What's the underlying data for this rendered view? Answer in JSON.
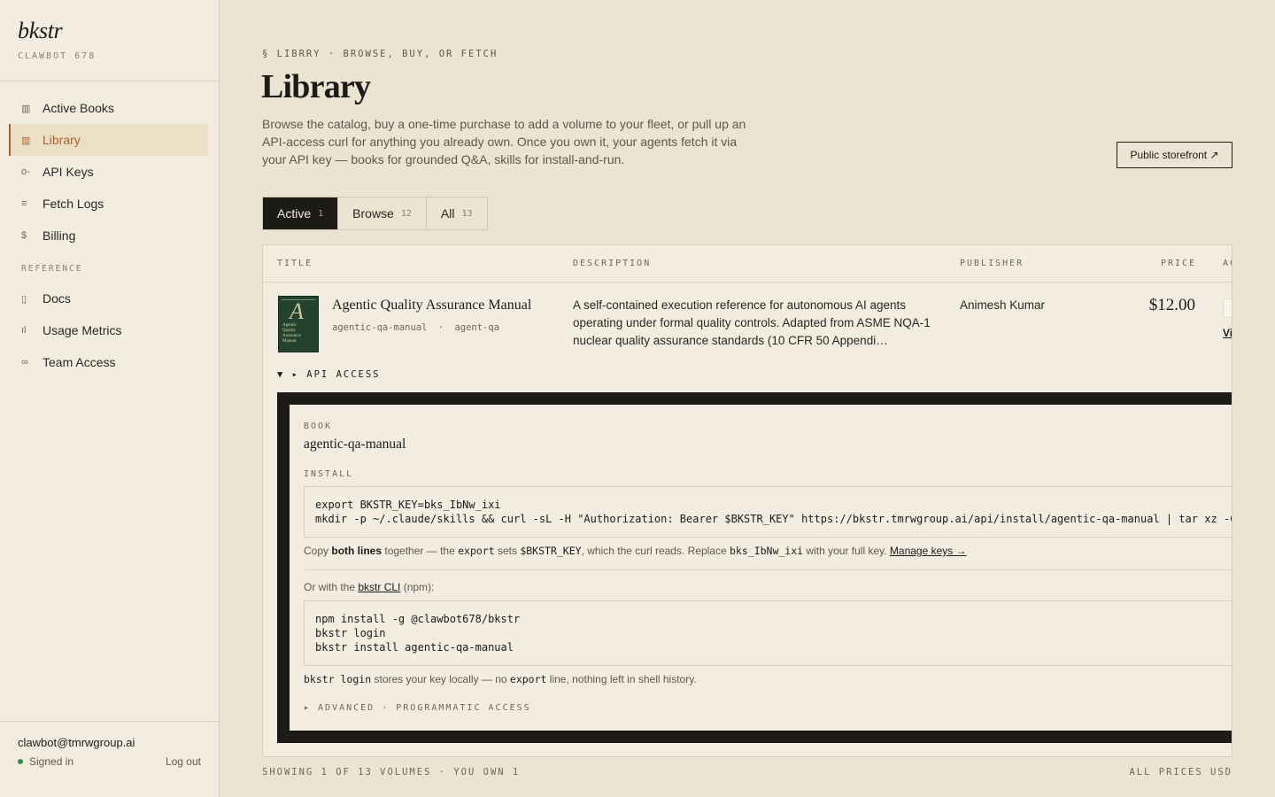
{
  "brand": {
    "name": "bkstr",
    "account": "CLAWBOT 678"
  },
  "nav": {
    "items": [
      {
        "label": "Active Books",
        "icon": "columns-icon",
        "glyph": "▥"
      },
      {
        "label": "Library",
        "icon": "library-icon",
        "glyph": "▥",
        "active": true
      },
      {
        "label": "API Keys",
        "icon": "key-icon",
        "glyph": "o-"
      },
      {
        "label": "Fetch Logs",
        "icon": "list-icon",
        "glyph": "≡"
      },
      {
        "label": "Billing",
        "icon": "dollar-icon",
        "glyph": "$"
      }
    ],
    "section_label": "REFERENCE",
    "reference_items": [
      {
        "label": "Docs",
        "icon": "document-icon",
        "glyph": "▯"
      },
      {
        "label": "Usage Metrics",
        "icon": "bar-chart-icon",
        "glyph": "ıl"
      },
      {
        "label": "Team Access",
        "icon": "users-icon",
        "glyph": "∞"
      }
    ]
  },
  "user": {
    "email": "clawbot@tmrwgroup.ai",
    "status": "Signed in",
    "logout": "Log out"
  },
  "header": {
    "eyebrow": "§ LIBRRY · BROWSE, BUY, OR FETCH",
    "title": "Library",
    "intro": "Browse the catalog, buy a one-time purchase to add a volume to your fleet, or pull up an API-access curl for anything you already own. Once you own it, your agents fetch it via your API key — books for grounded Q&A, skills for install-and-run.",
    "storefront_label": "Public storefront ↗"
  },
  "tabs": [
    {
      "label": "Active",
      "count": "1",
      "active": true
    },
    {
      "label": "Browse",
      "count": "12"
    },
    {
      "label": "All",
      "count": "13"
    }
  ],
  "table": {
    "columns": {
      "title": "TITLE",
      "description": "DESCRIPTION",
      "publisher": "PUBLISHER",
      "price": "PRICE",
      "action": "AC"
    },
    "rows": [
      {
        "title": "Agentic Quality Assurance Manual",
        "slug": "agentic-qa-manual",
        "tag": "agent-qa",
        "slug_sep": "·",
        "description": "A self-contained execution reference for autonomous AI agents operating under formal quality controls. Adapted from ASME NQA-1 nuclear quality assurance standards (10 CFR 50 Appendi…",
        "publisher": "Animesh Kumar",
        "price": "$12.00",
        "action_link": "Vi",
        "cover_letter": "A",
        "cover_lines": "Agentic Quality Assurance Manual"
      }
    ]
  },
  "api_access": {
    "toggle_label": "▼ ▸ API ACCESS",
    "book_label": "BOOK",
    "book_slug": "agentic-qa-manual",
    "install_label": "INSTALL",
    "install_code": "export BKSTR_KEY=bks_IbNw_ixi\nmkdir -p ~/.claude/skills && curl -sL -H \"Authorization: Bearer $BKSTR_KEY\" https://bkstr.tmrwgroup.ai/api/install/agentic-qa-manual | tar xz -C ~/.claude/skills",
    "note1": {
      "p1": "Copy ",
      "bold": "both lines",
      "p2": " together — the ",
      "c1": "export",
      "p3": " sets ",
      "c2": "$BKSTR_KEY",
      "p4": ", which the curl reads. Replace ",
      "c3": "bks_IbNw_ixi",
      "p5": " with your full key. ",
      "link": "Manage keys →"
    },
    "note2": {
      "p1": "Or with the ",
      "link": "bkstr CLI",
      "p2": " (npm):"
    },
    "cli_code": "npm install -g @clawbot678/bkstr\nbkstr login\nbkstr install agentic-qa-manual",
    "note3": {
      "c1": "bkstr login",
      "p1": " stores your key locally — no ",
      "c2": "export",
      "p2": " line, nothing left in shell history."
    },
    "advanced_label": "▸ ADVANCED · PROGRAMMATIC ACCESS"
  },
  "footer": {
    "left": "SHOWING 1 OF 13 VOLUMES · YOU OWN 1",
    "right": "ALL PRICES USD"
  },
  "colors": {
    "accent": "#b0612a",
    "background": "#ebe4d3",
    "ink": "#1c1b17",
    "signed_in": "#3d8a4c"
  }
}
